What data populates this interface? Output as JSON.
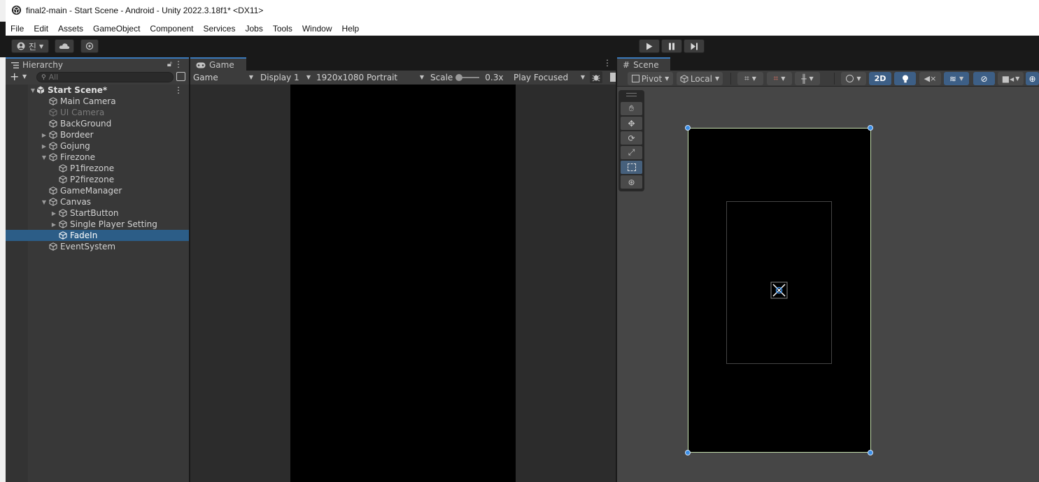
{
  "window": {
    "title": "final2-main - Start Scene - Android - Unity 2022.3.18f1* <DX11>"
  },
  "menu": [
    "File",
    "Edit",
    "Assets",
    "GameObject",
    "Component",
    "Services",
    "Jobs",
    "Tools",
    "Window",
    "Help"
  ],
  "toolbar": {
    "account_label": "진"
  },
  "hierarchy": {
    "tab_label": "Hierarchy",
    "search_placeholder": "All",
    "scene_name": "Start Scene*",
    "items": [
      {
        "label": "Main Camera"
      },
      {
        "label": "UI Camera"
      },
      {
        "label": "BackGround"
      },
      {
        "label": "Bordeer"
      },
      {
        "label": "Gojung"
      },
      {
        "label": "Firezone"
      },
      {
        "label": "P1firezone"
      },
      {
        "label": "P2firezone"
      },
      {
        "label": "GameManager"
      },
      {
        "label": "Canvas"
      },
      {
        "label": "StartButton"
      },
      {
        "label": "Single Player Setting"
      },
      {
        "label": "FadeIn"
      },
      {
        "label": "EventSystem"
      }
    ]
  },
  "game": {
    "tab_label": "Game",
    "mode": "Game",
    "display": "Display 1",
    "resolution": "1920x1080 Portrait",
    "scale_label": "Scale",
    "scale_value": "0.3x",
    "play_mode": "Play Focused"
  },
  "scene": {
    "tab_label": "Scene",
    "pivot": "Pivot",
    "space": "Local",
    "mode_2d": "2D"
  },
  "colors": {
    "selection": "#2c5d87",
    "accent": "#3a79bb"
  }
}
